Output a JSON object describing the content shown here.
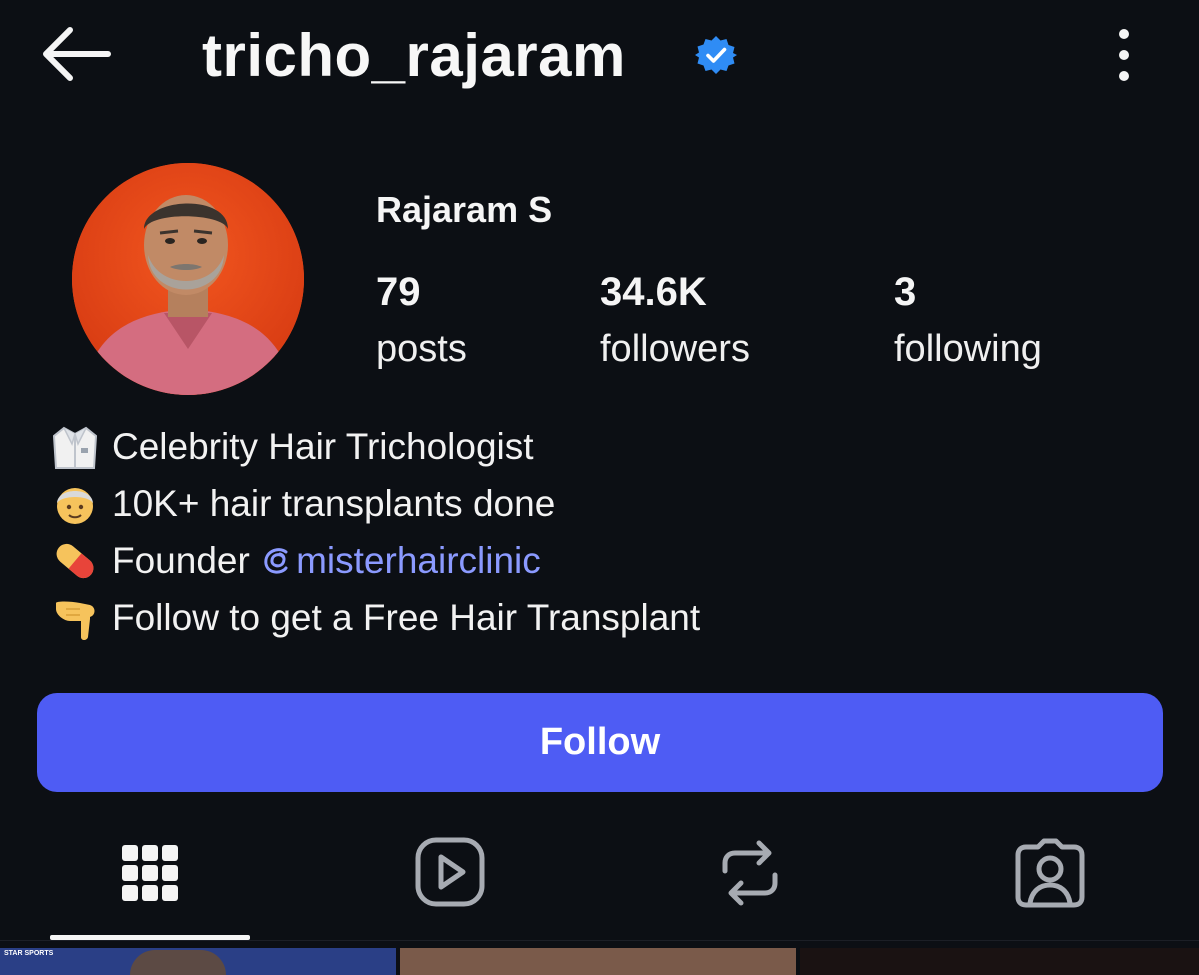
{
  "header": {
    "username": "tricho_rajaram",
    "back_icon": "arrow-left-icon",
    "verified_icon": "verified-badge-icon",
    "more_icon": "more-vertical-icon",
    "colors": {
      "verified": "#2f8cf5",
      "background": "#0c0f14"
    }
  },
  "profile": {
    "display_name": "Rajaram S",
    "avatar_icon": "profile-photo",
    "stats": [
      {
        "value": "79",
        "label": "posts"
      },
      {
        "value": "34.6K",
        "label": "followers"
      },
      {
        "value": "3",
        "label": "following"
      }
    ]
  },
  "bio": {
    "lines": [
      {
        "emoji": "lab-coat-emoji",
        "text": "Celebrity Hair Trichologist"
      },
      {
        "emoji": "older-person-emoji",
        "text": "10K+ hair transplants done"
      },
      {
        "emoji": "pill-emoji",
        "text": "Founder ",
        "mention": "misterhairclinic"
      },
      {
        "emoji": "pointing-down-emoji",
        "text": "Follow to get a Free Hair Transplant"
      }
    ],
    "mention_color": "#8b9aff"
  },
  "actions": {
    "follow_label": "Follow",
    "follow_color": "#4e5cf4"
  },
  "tabs": [
    {
      "icon": "grid-icon",
      "active": true
    },
    {
      "icon": "reels-icon",
      "active": false
    },
    {
      "icon": "reposts-icon",
      "active": false
    },
    {
      "icon": "tagged-icon",
      "active": false
    }
  ],
  "thumbnails": {
    "first_label": "STAR SPORTS"
  }
}
